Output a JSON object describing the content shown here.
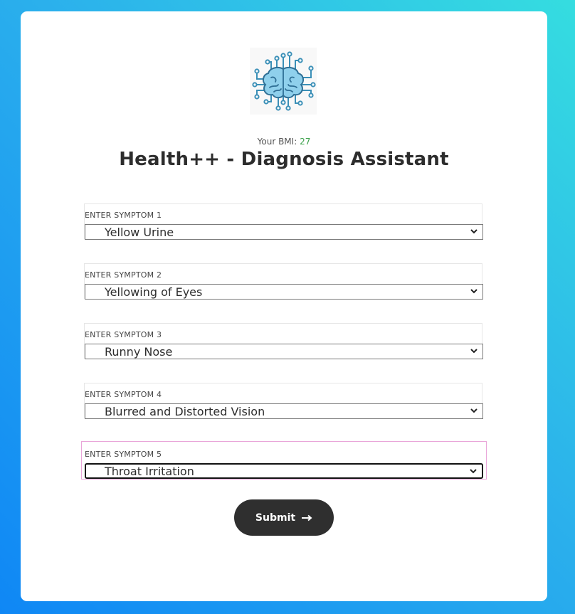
{
  "header": {
    "bmi_label": "Your BMI:",
    "bmi_value": "27",
    "title": "Health++ - Diagnosis Assistant",
    "logo_icon": "brain-circuit-icon"
  },
  "symptoms": [
    {
      "label": "ENTER SYMPTOM 1",
      "value": "Yellow Urine"
    },
    {
      "label": "ENTER SYMPTOM 2",
      "value": "Yellowing of Eyes"
    },
    {
      "label": "ENTER SYMPTOM 3",
      "value": "Runny Nose"
    },
    {
      "label": "ENTER SYMPTOM 4",
      "value": "Blurred and Distorted Vision"
    },
    {
      "label": "ENTER SYMPTOM 5",
      "value": "Throat Irritation"
    }
  ],
  "submit": {
    "label": "Submit",
    "icon": "arrow-right-icon"
  },
  "colors": {
    "bmi_value": "#3aa14a",
    "button": "#2f2f2f",
    "focus_ring": "#e9a6d9"
  }
}
